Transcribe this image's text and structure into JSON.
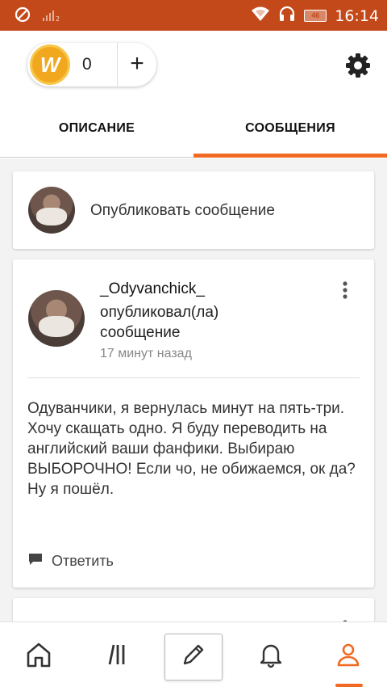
{
  "status_bar": {
    "time": "16:14",
    "battery": "46",
    "icons": [
      "do-not-disturb-icon",
      "signal-icon",
      "wifi-icon",
      "headphones-icon",
      "battery-icon"
    ]
  },
  "header": {
    "coin_count": "0",
    "coin_symbol": "W",
    "add_label": "+",
    "tabs": [
      {
        "label": "ОПИСАНИЕ",
        "active": false
      },
      {
        "label": "СООБЩЕНИЯ",
        "active": true
      }
    ]
  },
  "compose": {
    "placeholder": "Опубликовать сообщение"
  },
  "post": {
    "author": "_Odyvanchick_",
    "action": "опубликовал(ла) сообщение",
    "time": "17 минут назад",
    "body": "Одуванчики, я вернулась минут на пять-три.\nХочу скащать одно. Я буду переводить на английский ваши фанфики. Выбираю ВЫБОРОЧНО! Если чо, не обижаемся, ок да? Ну я пошёл.",
    "reply_label": "Ответить"
  },
  "bottom_nav": {
    "items": [
      {
        "name": "home",
        "icon": "home-icon",
        "active": false
      },
      {
        "name": "library",
        "icon": "library-icon",
        "active": false
      },
      {
        "name": "write",
        "icon": "pencil-icon",
        "active": false
      },
      {
        "name": "notifications",
        "icon": "bell-icon",
        "active": false
      },
      {
        "name": "profile",
        "icon": "user-icon",
        "active": true
      }
    ]
  },
  "colors": {
    "status_bar": "#c4491a",
    "accent": "#f06a23",
    "coin": "#f2a81e"
  }
}
